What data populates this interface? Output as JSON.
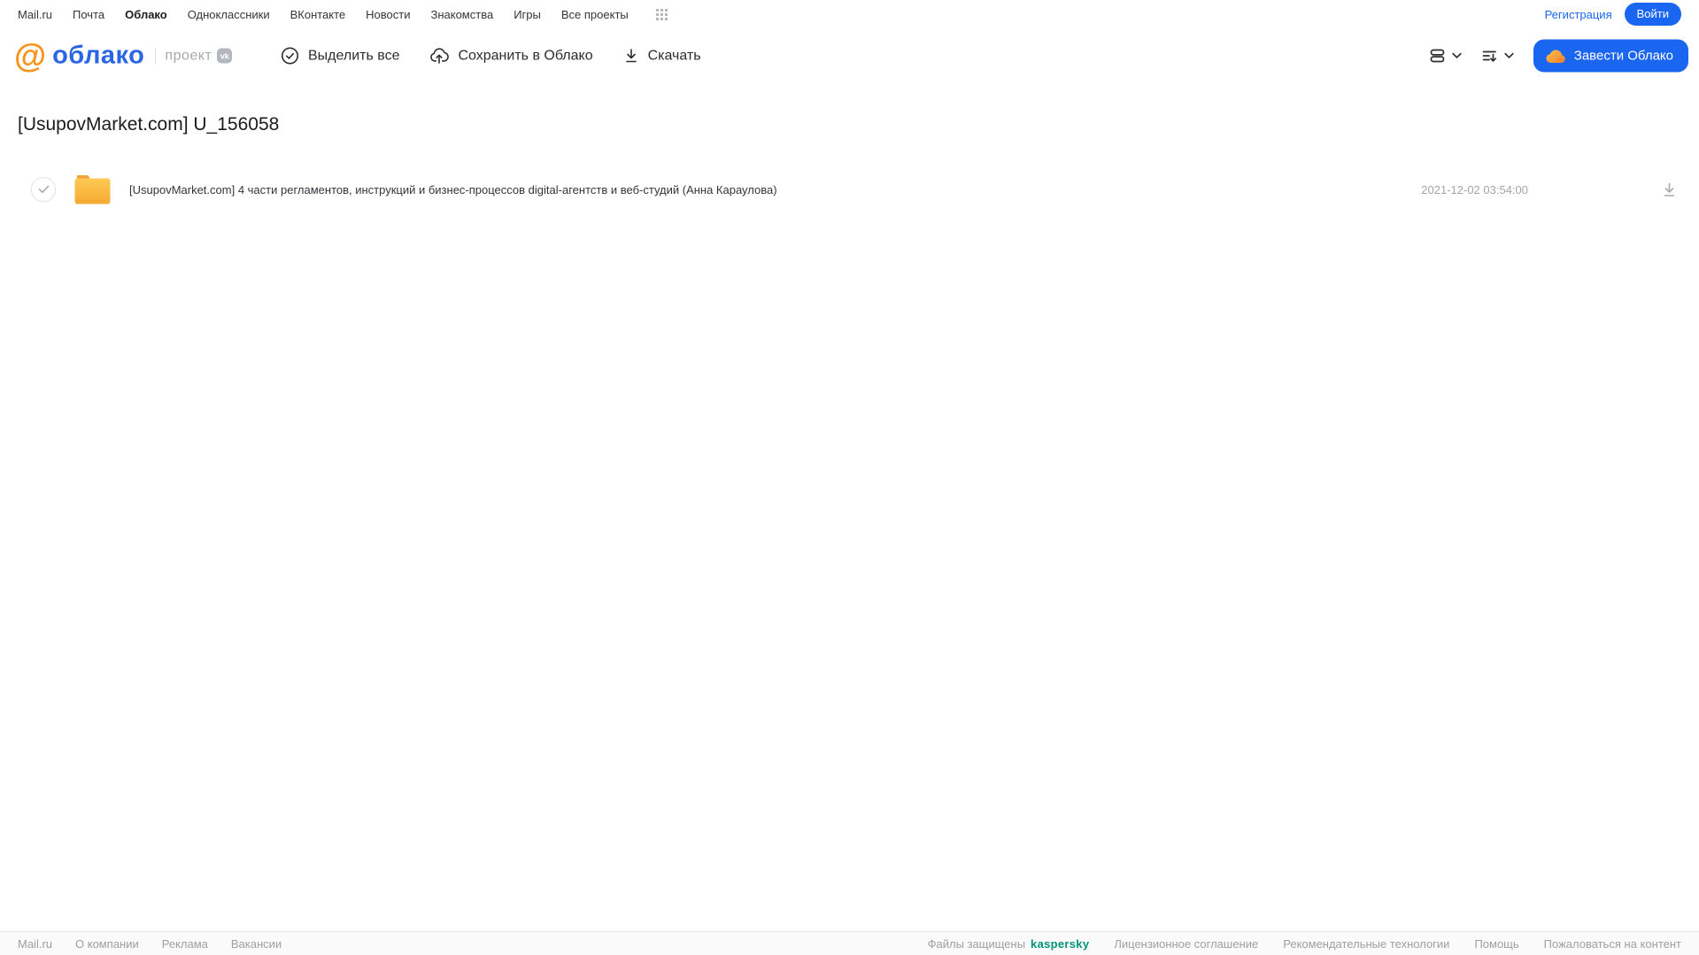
{
  "topnav": {
    "items": [
      "Mail.ru",
      "Почта",
      "Облако",
      "Одноклассники",
      "ВКонтакте",
      "Новости",
      "Знакомства",
      "Игры",
      "Все проекты"
    ],
    "registration_label": "Регистрация",
    "login_label": "Войти"
  },
  "header": {
    "logo_at": "@",
    "logo_word": "облако",
    "project_label": "проект",
    "vk_badge": "vk",
    "toolbar": {
      "select_all_label": "Выделить все",
      "save_to_cloud_label": "Сохранить в Облако",
      "download_label": "Скачать"
    },
    "get_cloud_label": "Завести Облако"
  },
  "main": {
    "title": "[UsupovMarket.com] U_156058",
    "file": {
      "type": "folder",
      "name": "[UsupovMarket.com] 4 части регламентов, инструкций и бизнес-процессов digital-агентств и веб-студий (Анна Караулова)",
      "date": "2021-12-02 03:54:00"
    }
  },
  "footer": {
    "left_links": [
      "Mail.ru",
      "О компании",
      "Реклама",
      "Вакансии"
    ],
    "protected_label": "Файлы защищены",
    "kaspersky_label": "kaspersky",
    "right_links": [
      "Лицензионное соглашение",
      "Рекомендательные технологии",
      "Помощь",
      "Пожаловаться на контент"
    ]
  },
  "icons": [
    "apps-grid-icon",
    "check-circle-icon",
    "cloud-upload-icon",
    "download-icon",
    "view-mode-icon",
    "sort-icon",
    "chevron-down-icon",
    "cloud-icon",
    "folder-icon",
    "check-icon",
    "vk-badge-icon",
    "at-logo-icon"
  ],
  "colors": {
    "accent_blue": "#1b66f0",
    "logo_blue": "#2a66e4",
    "logo_orange": "#f8941d",
    "folder_yellow_top": "#ffca55",
    "folder_yellow_bottom": "#f5a931",
    "kaspersky_green": "#009479",
    "muted_gray": "#a2a5a8"
  }
}
